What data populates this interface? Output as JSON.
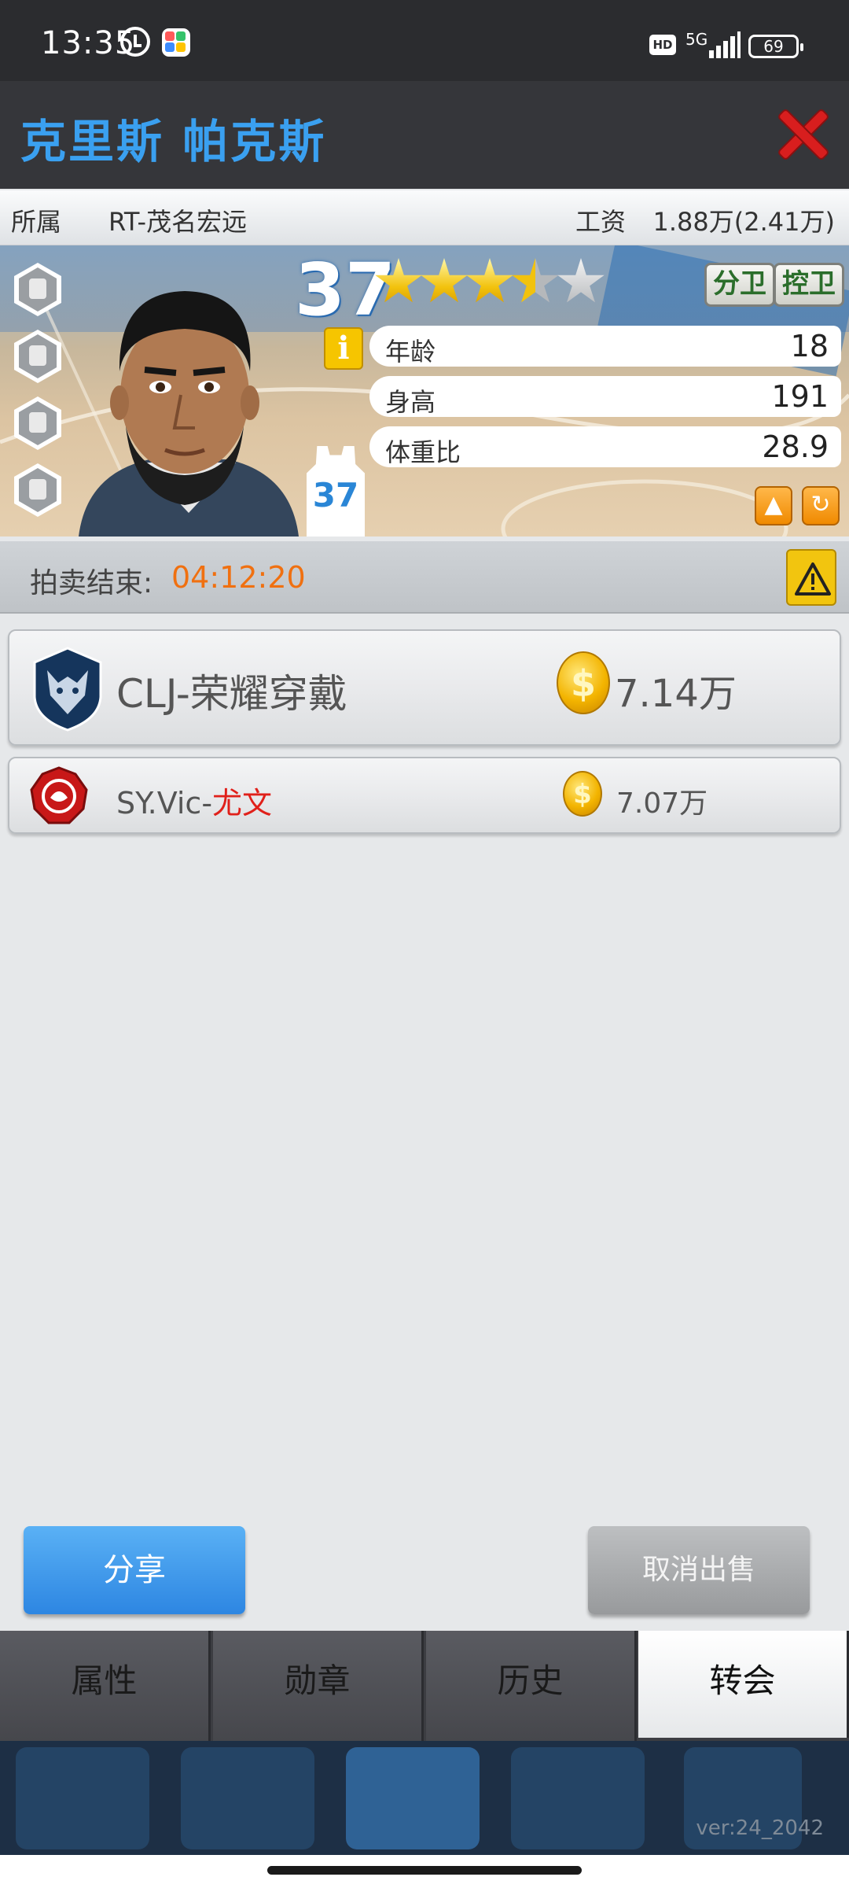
{
  "status_bar": {
    "time": "13:35",
    "network": "5G",
    "hd": "HD",
    "battery": "69",
    "icons": [
      "alarm-icon",
      "app-icon",
      "hd-icon",
      "signal-icon",
      "battery-icon"
    ]
  },
  "header": {
    "title": "克里斯 帕克斯",
    "close_icon": "close-icon"
  },
  "team_row": {
    "team_label": "所属",
    "team_value": "RT-茂名宏远",
    "salary_label": "工资",
    "salary_value": "1.88万(2.41万)"
  },
  "player": {
    "rating": "37",
    "stars": 3.5,
    "stars_max": 5,
    "positions": [
      "分卫",
      "控卫"
    ],
    "info_icon": "i",
    "stats": [
      {
        "label": "年龄",
        "value": "18"
      },
      {
        "label": "身高",
        "value": "191"
      },
      {
        "label": "体重比",
        "value": "28.9"
      }
    ],
    "jersey_number": "37",
    "locked_slots": 4
  },
  "auction": {
    "label": "拍卖结束:",
    "timer": "04:12:20"
  },
  "bids": [
    {
      "team": "CLJ-荣耀穿戴",
      "amount": "7.14万"
    },
    {
      "team_prefix": "SY.Vic-",
      "team_suffix": "尤文",
      "amount": "7.07万"
    }
  ],
  "actions": {
    "share": "分享",
    "cancel_sale": "取消出售"
  },
  "tabs": [
    {
      "label": "属性",
      "active": false
    },
    {
      "label": "勋章",
      "active": false
    },
    {
      "label": "历史",
      "active": false
    },
    {
      "label": "转会",
      "active": true
    }
  ],
  "footer": {
    "version": "ver:24_2042"
  },
  "colors": {
    "title_blue": "#3aa0f0",
    "timer_orange": "#f07010",
    "highlight_red": "#e0201a",
    "close_red": "#d81e1e"
  }
}
